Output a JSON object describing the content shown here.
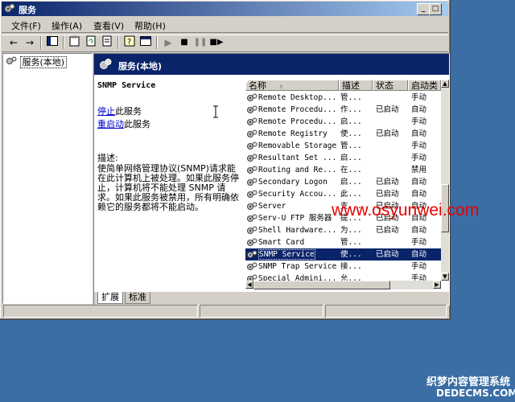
{
  "window": {
    "title": "服务"
  },
  "menu": [
    "文件(F)",
    "操作(A)",
    "查看(V)",
    "帮助(H)"
  ],
  "tree": {
    "root": "服务(本地)"
  },
  "pane_header": "服务(本地)",
  "selected_service": {
    "name": "SNMP Service",
    "stop_link": "停止",
    "stop_suffix": "此服务",
    "restart_link": "重启动",
    "restart_suffix": "此服务",
    "desc_label": "描述:",
    "description": "使简单网络管理协议(SNMP)请求能在此计算机上被处理。如果此服务停止，计算机将不能处理 SNMP 请求。如果此服务被禁用，所有明确依赖它的服务都将不能启动。"
  },
  "columns": [
    "名称",
    "描述",
    "状态",
    "启动类"
  ],
  "services": [
    {
      "name": "Remote Desktop...",
      "desc": "管...",
      "status": "",
      "startup": "手动"
    },
    {
      "name": "Remote Procedu...",
      "desc": "作...",
      "status": "已启动",
      "startup": "自动"
    },
    {
      "name": "Remote Procedu...",
      "desc": "启...",
      "status": "",
      "startup": "手动"
    },
    {
      "name": "Remote Registry",
      "desc": "使...",
      "status": "已启动",
      "startup": "自动"
    },
    {
      "name": "Removable Storage",
      "desc": "管...",
      "status": "",
      "startup": "手动"
    },
    {
      "name": "Resultant Set ...",
      "desc": "启...",
      "status": "",
      "startup": "手动"
    },
    {
      "name": "Routing and Re...",
      "desc": "在...",
      "status": "",
      "startup": "禁用"
    },
    {
      "name": "Secondary Logon",
      "desc": "启...",
      "status": "已启动",
      "startup": "自动"
    },
    {
      "name": "Security Accou...",
      "desc": "此...",
      "status": "已启动",
      "startup": "自动"
    },
    {
      "name": "Server",
      "desc": "支...",
      "status": "已启动",
      "startup": "自动"
    },
    {
      "name": "Serv-U FTP 服务器",
      "desc": "提...",
      "status": "已启动",
      "startup": "自动"
    },
    {
      "name": "Shell Hardware...",
      "desc": "为...",
      "status": "已启动",
      "startup": "自动"
    },
    {
      "name": "Smart Card",
      "desc": "管...",
      "status": "",
      "startup": "手动"
    },
    {
      "name": "SNMP Service",
      "desc": "使...",
      "status": "已启动",
      "startup": "自动",
      "selected": true
    },
    {
      "name": "SNMP Trap Service",
      "desc": "接...",
      "status": "",
      "startup": "手动"
    },
    {
      "name": "Special Admini...",
      "desc": "允...",
      "status": "",
      "startup": "手动"
    }
  ],
  "tabs": [
    "扩展",
    "标准"
  ],
  "watermark": "www.osyunwei.com",
  "corner_mark": {
    "line1": "织梦内容管理系统",
    "line2": "DEDECMS.COM"
  },
  "colors": {
    "titlebar_start": "#0a246a",
    "titlebar_end": "#a6caf0",
    "selection": "#0a246a",
    "watermark": "#e60000",
    "desktop": "#3a6ea5"
  }
}
